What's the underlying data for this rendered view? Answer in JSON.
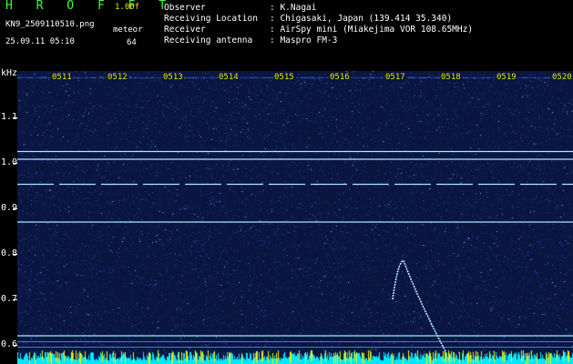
{
  "header": {
    "app_title": "H R O F F T",
    "version": "1.00f",
    "filename": "KN9_2509110510.png",
    "datetime": "25.09.11 05:10",
    "mode": "meteor",
    "count": "64",
    "info": [
      {
        "key": "Observer",
        "value": ": K.Nagai"
      },
      {
        "key": "Receiving Location",
        "value": ": Chigasaki, Japan (139.414 35.340)"
      },
      {
        "key": "Receiver",
        "value": ": AirSpy mini (Miakejima VOR 108.65MHz)"
      },
      {
        "key": "Receiving antenna",
        "value": ": Maspro FM-3"
      }
    ]
  },
  "chart_data": {
    "type": "heatmap",
    "ylabel": "kHz",
    "y_ticks": [
      "1.1",
      "1.0",
      "0.9",
      "0.8",
      "0.7",
      "0.6"
    ],
    "x_ticks": [
      "0511",
      "0512",
      "0513",
      "0514",
      "0515",
      "0516",
      "0517",
      "0518",
      "0519",
      "0520"
    ],
    "ylim": [
      0.58,
      1.18
    ],
    "horizontal_signals_khz": [
      1.025,
      1.008,
      0.953,
      0.87,
      0.62
    ],
    "meteor_echo": {
      "time": "0517",
      "peak_khz": 0.785
    },
    "colors": {
      "background": "#0a1540",
      "signal": "#a8e8ff",
      "label": "#e6e600",
      "title": "#3cff3c"
    }
  }
}
